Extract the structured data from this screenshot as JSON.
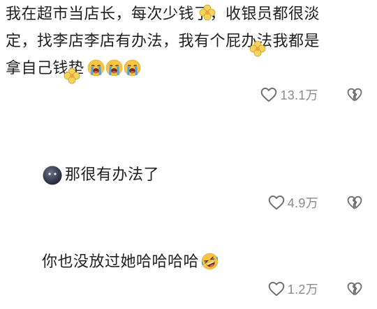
{
  "comments": [
    {
      "lines": [
        "我在超市当店长，每次少钱了，收银员都很淡",
        "定，找李店李店有办法，我有个屁办法我都是",
        "拿自己钱垫"
      ],
      "trailing_emojis": [
        "loudly-crying-face",
        "loudly-crying-face",
        "loudly-crying-face"
      ],
      "likes": "13.1万"
    },
    {
      "leading_emoji": "dark-blob-face",
      "text": "那很有办法了",
      "likes": "4.9万"
    },
    {
      "text": "你也没放过她哈哈哈哈",
      "trailing_emoji": "rolling-laughing-face",
      "likes": "1.2万"
    }
  ],
  "icons": {
    "like": "heart-outline-icon",
    "dislike": "broken-heart-icon",
    "sticker": "paw-flower-sticker"
  },
  "colors": {
    "text": "#1f1f1f",
    "muted": "#8a8a8a",
    "icon": "#7a7a7a",
    "emoji_yellow": "#f6c343",
    "tear_blue": "#4aa3e8"
  }
}
